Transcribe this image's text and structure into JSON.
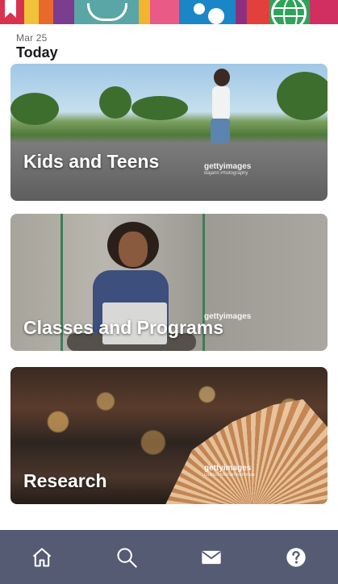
{
  "date_header": {
    "date": "Mar 25",
    "title": "Today"
  },
  "cards": [
    {
      "label": "Kids and Teens",
      "watermark": "gettyimages",
      "credit": "Bajarin Photography"
    },
    {
      "label": "Classes and Programs",
      "watermark": "gettyimages",
      "credit": ""
    },
    {
      "label": "Research",
      "watermark": "gettyimages",
      "credit": "Gulliva Muhametdinova"
    }
  ],
  "bottom_nav": {
    "items": [
      {
        "icon": "home-icon"
      },
      {
        "icon": "search-icon"
      },
      {
        "icon": "mail-icon"
      },
      {
        "icon": "help-icon"
      }
    ]
  },
  "colors": {
    "nav_background": "#555b73",
    "nav_icon": "#ffffff",
    "card_label": "#ffffff"
  }
}
